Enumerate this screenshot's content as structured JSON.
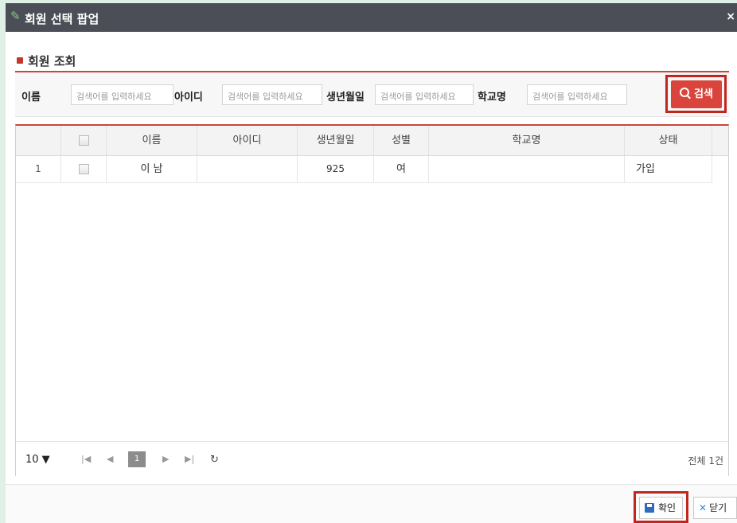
{
  "titlebar": {
    "title": "회원 선택 팝업",
    "close": "×"
  },
  "section": {
    "title": "회원 조회"
  },
  "search": {
    "fields": [
      {
        "label": "이름",
        "placeholder": "검색어를 입력하세요"
      },
      {
        "label": "아이디",
        "placeholder": "검색어를 입력하세요"
      },
      {
        "label": "생년월일",
        "placeholder": "검색어를 입력하세요"
      },
      {
        "label": "학교명",
        "placeholder": "검색어를 입력하세요"
      }
    ],
    "button": "검색"
  },
  "grid": {
    "columns": [
      "이름",
      "아이디",
      "생년월일",
      "성별",
      "학교명",
      "상태"
    ],
    "rows": [
      {
        "no": "1",
        "name": "이 남",
        "id": "",
        "birth": "925",
        "gender": "여",
        "school": "",
        "status": "가입"
      }
    ]
  },
  "pager": {
    "page_size": "10 ▼",
    "current_page": "1",
    "total": "전체 1건"
  },
  "footer": {
    "ok": "확인",
    "close": "닫기"
  }
}
